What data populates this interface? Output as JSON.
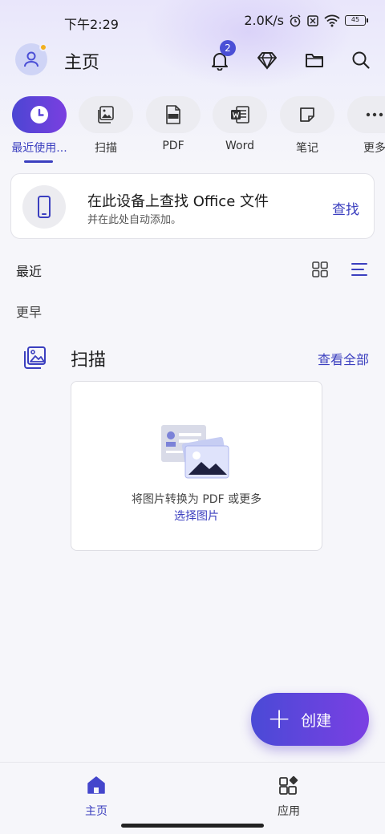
{
  "status_bar": {
    "time": "下午2:29",
    "network_speed": "2.0K/s",
    "battery": "45"
  },
  "header": {
    "title": "主页",
    "notification_count": "2"
  },
  "quick_actions": [
    {
      "label": "最近使用...",
      "icon": "clock-icon",
      "active": true
    },
    {
      "label": "扫描",
      "icon": "image-icon"
    },
    {
      "label": "PDF",
      "icon": "pdf-icon"
    },
    {
      "label": "Word",
      "icon": "word-icon"
    },
    {
      "label": "笔记",
      "icon": "note-icon"
    },
    {
      "label": "更多",
      "icon": "more-icon"
    }
  ],
  "find_card": {
    "title": "在此设备上查找 Office 文件",
    "subtitle": "并在此处自动添加。",
    "action": "查找"
  },
  "recent": {
    "heading": "最近",
    "earlier": "更早"
  },
  "scan_section": {
    "title": "扫描",
    "view_all": "查看全部",
    "description": "将图片转换为 PDF 或更多",
    "link": "选择图片"
  },
  "fab": {
    "label": "创建"
  },
  "bottom_nav": [
    {
      "label": "主页",
      "active": true
    },
    {
      "label": "应用"
    }
  ],
  "colors": {
    "accent": "#3b3fbf",
    "fab_start": "#4a4ad6",
    "fab_end": "#7b3fe3"
  }
}
